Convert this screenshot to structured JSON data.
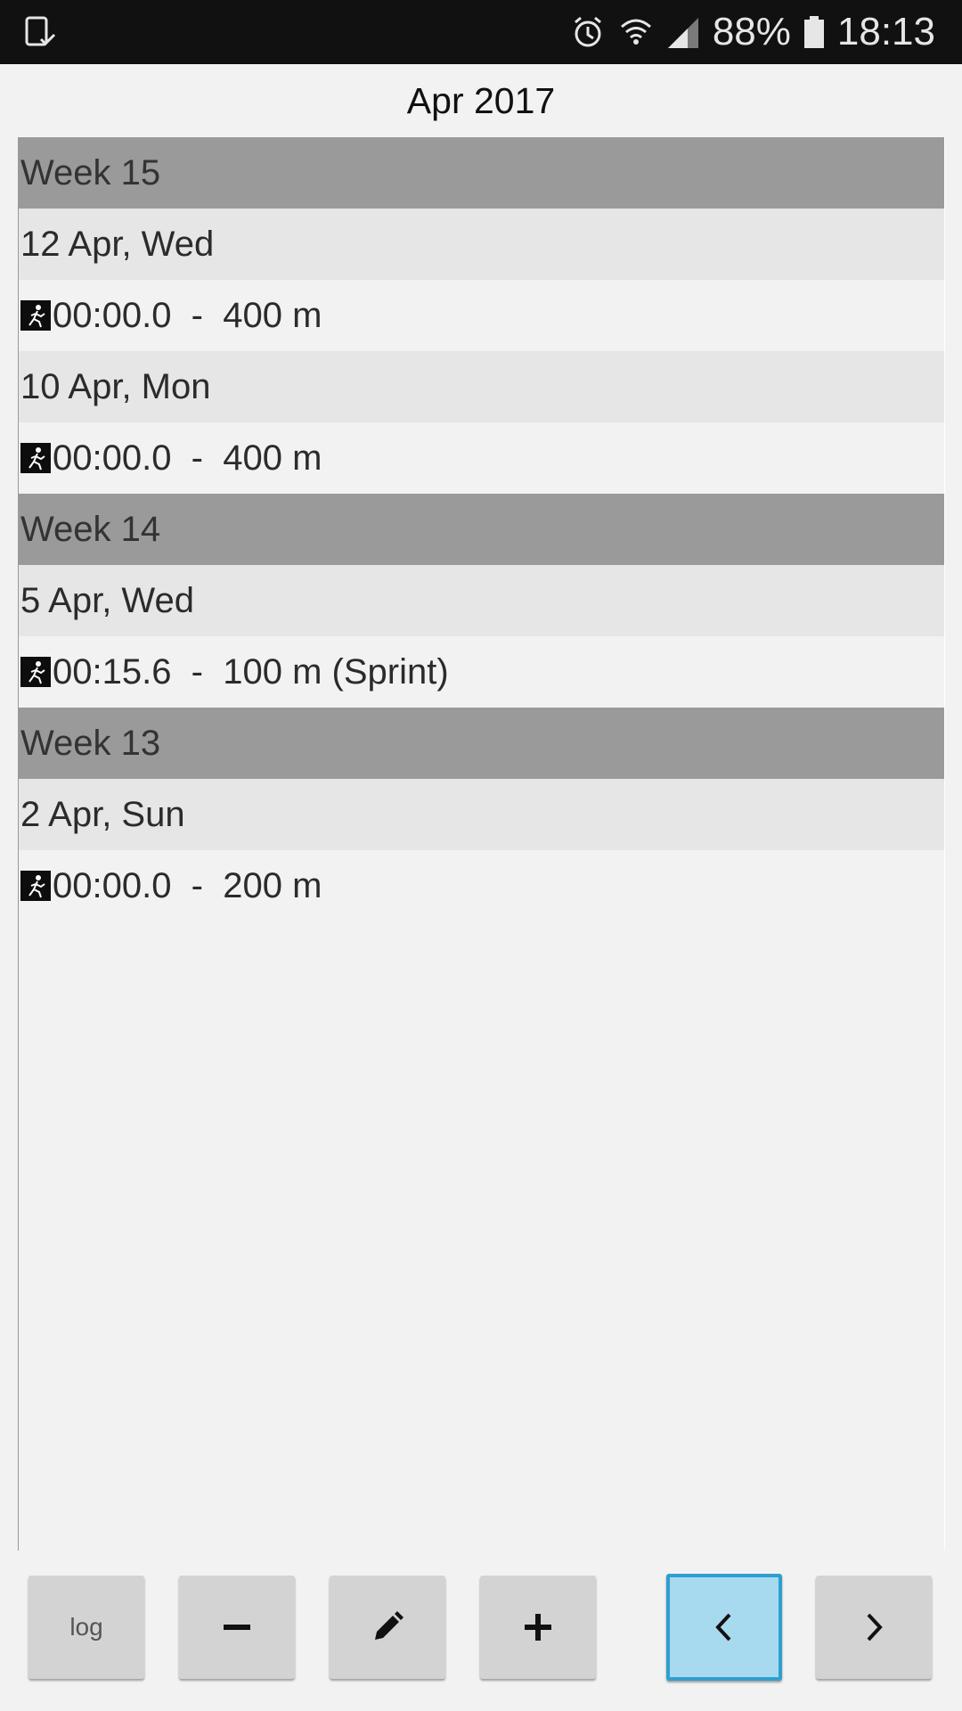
{
  "status_bar": {
    "battery_percent": "88%",
    "time": "18:13",
    "icons": [
      "screenshot-saved-icon",
      "alarm-icon",
      "wifi-icon",
      "signal-icon",
      "battery-icon"
    ]
  },
  "title": "Apr 2017",
  "list": {
    "rows": [
      {
        "type": "week",
        "text": "Week 15"
      },
      {
        "type": "day",
        "text": "12 Apr, Wed"
      },
      {
        "type": "entry",
        "text": "00:00.0  -  400 m"
      },
      {
        "type": "day",
        "text": "10 Apr, Mon"
      },
      {
        "type": "entry",
        "text": "00:00.0  -  400 m"
      },
      {
        "type": "week",
        "text": "Week 14"
      },
      {
        "type": "day",
        "text": "5 Apr, Wed"
      },
      {
        "type": "entry",
        "text": "00:15.6  -  100 m (Sprint)"
      },
      {
        "type": "week",
        "text": "Week 13"
      },
      {
        "type": "day",
        "text": "2 Apr, Sun"
      },
      {
        "type": "entry",
        "text": "00:00.0  -  200 m"
      }
    ]
  },
  "toolbar": {
    "log_label": "log",
    "buttons": [
      "log-button",
      "remove-button",
      "edit-button",
      "add-button",
      "previous-month-button",
      "next-month-button"
    ],
    "active_button": "previous-month-button",
    "colors": {
      "button_bg": "#d3d3d3",
      "active_bg": "#a7d9ef",
      "active_border": "#2e9fcf"
    }
  },
  "colors": {
    "week_header": "#9a9a9a",
    "day_header": "#e6e6e6",
    "background": "#f2f2f2",
    "status_bar": "#111111"
  }
}
